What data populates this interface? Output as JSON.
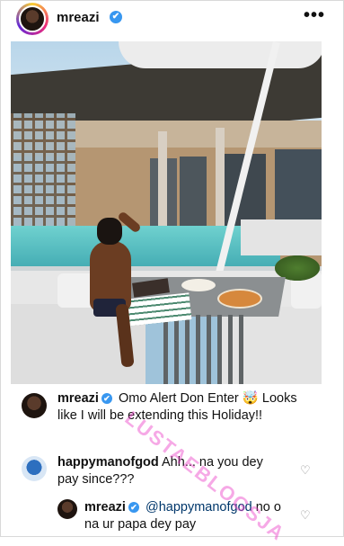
{
  "post": {
    "username": "mreazi",
    "verified_mark": "✔",
    "more_icon": "•••"
  },
  "comments": [
    {
      "username": "mreazi",
      "verified": true,
      "text": "Omo Alert Don Enter 🤯 Looks like I will be extending this Holiday!!"
    },
    {
      "username": "happymanofgod",
      "verified": false,
      "text": "Ahh... na you dey pay since???"
    },
    {
      "username": "mreazi",
      "verified": true,
      "mention": "@happymanofgod",
      "text": "no o na ur papa dey pay"
    }
  ],
  "watermark": "LUSTAEBLOGSJA",
  "heart_icon": "♡"
}
